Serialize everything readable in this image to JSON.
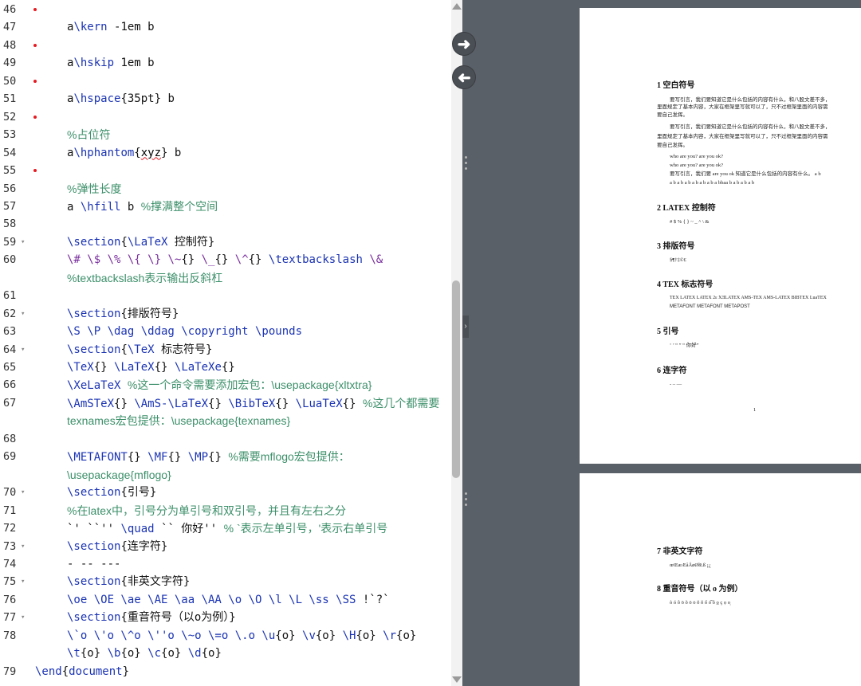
{
  "editor": {
    "lines": [
      {
        "ln": "46",
        "dot": true,
        "fold": false,
        "segs": []
      },
      {
        "ln": "47",
        "dot": false,
        "fold": false,
        "segs": [
          [
            "pl",
            "a"
          ],
          [
            "cmd",
            "\\kern"
          ],
          [
            "pl",
            " -1em b"
          ]
        ]
      },
      {
        "ln": "48",
        "dot": true,
        "fold": false,
        "segs": []
      },
      {
        "ln": "49",
        "dot": false,
        "fold": false,
        "segs": [
          [
            "pl",
            "a"
          ],
          [
            "cmd",
            "\\hskip"
          ],
          [
            "pl",
            " 1em b"
          ]
        ]
      },
      {
        "ln": "50",
        "dot": true,
        "fold": false,
        "segs": []
      },
      {
        "ln": "51",
        "dot": false,
        "fold": false,
        "segs": [
          [
            "pl",
            "a"
          ],
          [
            "cmd",
            "\\hspace"
          ],
          [
            "pl",
            "{35pt} b"
          ]
        ]
      },
      {
        "ln": "52",
        "dot": true,
        "fold": false,
        "segs": []
      },
      {
        "ln": "53",
        "dot": false,
        "fold": false,
        "segs": [
          [
            "cm",
            "%占位符"
          ]
        ]
      },
      {
        "ln": "54",
        "dot": false,
        "fold": false,
        "segs": [
          [
            "pl",
            "a"
          ],
          [
            "cmd",
            "\\hphantom"
          ],
          [
            "pl",
            "{"
          ],
          [
            "sq",
            "xyz"
          ],
          [
            "pl",
            "} b"
          ]
        ]
      },
      {
        "ln": "55",
        "dot": true,
        "fold": false,
        "segs": []
      },
      {
        "ln": "56",
        "dot": false,
        "fold": false,
        "segs": [
          [
            "cm",
            "%弹性长度"
          ]
        ]
      },
      {
        "ln": "57",
        "dot": false,
        "fold": false,
        "segs": [
          [
            "pl",
            "a "
          ],
          [
            "cmd",
            "\\hfill"
          ],
          [
            "pl",
            " b   "
          ],
          [
            "cm",
            "%撑满整个空间"
          ]
        ]
      },
      {
        "ln": "58",
        "dot": false,
        "fold": false,
        "segs": []
      },
      {
        "ln": "59",
        "dot": false,
        "fold": true,
        "segs": [
          [
            "cmd",
            "\\section"
          ],
          [
            "pl",
            "{"
          ],
          [
            "cmd",
            "\\LaTeX"
          ],
          [
            "pl",
            " 控制符}"
          ]
        ]
      },
      {
        "ln": "60",
        "dot": false,
        "fold": false,
        "segs": [
          [
            "kw",
            "\\# \\$ \\% \\{ \\}"
          ],
          [
            "pl",
            " "
          ],
          [
            "kw",
            "\\~"
          ],
          [
            "pl",
            "{} "
          ],
          [
            "kw",
            "\\_"
          ],
          [
            "pl",
            "{} "
          ],
          [
            "kw",
            "\\^"
          ],
          [
            "pl",
            "{} "
          ],
          [
            "cmd",
            "\\textbackslash"
          ],
          [
            "pl",
            " "
          ],
          [
            "kw",
            "\\&"
          ]
        ]
      },
      {
        "ln": "",
        "dot": false,
        "fold": false,
        "segs": [
          [
            "cm",
            "%textbackslash表示输出反斜杠"
          ]
        ]
      },
      {
        "ln": "61",
        "dot": false,
        "fold": false,
        "segs": []
      },
      {
        "ln": "62",
        "dot": false,
        "fold": true,
        "segs": [
          [
            "cmd",
            "\\section"
          ],
          [
            "pl",
            "{排版符号}"
          ]
        ]
      },
      {
        "ln": "63",
        "dot": false,
        "fold": false,
        "segs": [
          [
            "cmd",
            "\\S \\P \\dag \\ddag \\copyright \\pounds"
          ]
        ]
      },
      {
        "ln": "64",
        "dot": false,
        "fold": true,
        "segs": [
          [
            "cmd",
            "\\section"
          ],
          [
            "pl",
            "{"
          ],
          [
            "cmd",
            "\\TeX"
          ],
          [
            "pl",
            " 标志符号}"
          ]
        ]
      },
      {
        "ln": "65",
        "dot": false,
        "fold": false,
        "segs": [
          [
            "cmd",
            "\\TeX"
          ],
          [
            "pl",
            "{} "
          ],
          [
            "cmd",
            "\\LaTeX"
          ],
          [
            "pl",
            "{} "
          ],
          [
            "cmd",
            "\\LaTeXe"
          ],
          [
            "pl",
            "{}"
          ]
        ]
      },
      {
        "ln": "66",
        "dot": false,
        "fold": false,
        "segs": [
          [
            "cmd",
            "\\XeLaTeX"
          ],
          [
            "pl",
            "  "
          ],
          [
            "cm",
            "%这一个命令需要添加宏包：\\usepackage{xltxtra}"
          ]
        ]
      },
      {
        "ln": "67",
        "dot": false,
        "fold": false,
        "segs": [
          [
            "cmd",
            "\\AmSTeX"
          ],
          [
            "pl",
            "{} "
          ],
          [
            "cmd",
            "\\AmS-\\LaTeX"
          ],
          [
            "pl",
            "{} "
          ],
          [
            "cmd",
            "\\BibTeX"
          ],
          [
            "pl",
            "{} "
          ],
          [
            "cmd",
            "\\LuaTeX"
          ],
          [
            "pl",
            "{} "
          ],
          [
            "cm",
            "%这几个都需要"
          ]
        ]
      },
      {
        "ln": "",
        "dot": false,
        "fold": false,
        "segs": [
          [
            "cm",
            "texnames宏包提供：\\usepackage{texnames}"
          ]
        ]
      },
      {
        "ln": "68",
        "dot": false,
        "fold": false,
        "segs": []
      },
      {
        "ln": "69",
        "dot": false,
        "fold": false,
        "segs": [
          [
            "cmd",
            "\\METAFONT"
          ],
          [
            "pl",
            "{} "
          ],
          [
            "cmd",
            "\\MF"
          ],
          [
            "pl",
            "{} "
          ],
          [
            "cmd",
            "\\MP"
          ],
          [
            "pl",
            "{} "
          ],
          [
            "cm",
            "%需要mflogo宏包提供："
          ]
        ]
      },
      {
        "ln": "",
        "dot": false,
        "fold": false,
        "segs": [
          [
            "cm",
            "\\usepackage{mflogo}"
          ]
        ]
      },
      {
        "ln": "70",
        "dot": false,
        "fold": true,
        "segs": [
          [
            "cmd",
            "\\section"
          ],
          [
            "pl",
            "{引号}"
          ]
        ]
      },
      {
        "ln": "71",
        "dot": false,
        "fold": false,
        "segs": [
          [
            "cm",
            "%在latex中，引号分为单引号和双引号，并且有左右之分"
          ]
        ]
      },
      {
        "ln": "72",
        "dot": false,
        "fold": false,
        "segs": [
          [
            "pl",
            "`' ``'' "
          ],
          [
            "cmd",
            "\\quad"
          ],
          [
            "pl",
            "   `` 你好'' "
          ],
          [
            "cm",
            "% `表示左单引号，'表示右单引号"
          ]
        ]
      },
      {
        "ln": "73",
        "dot": false,
        "fold": true,
        "segs": [
          [
            "cmd",
            "\\section"
          ],
          [
            "pl",
            "{连字符}"
          ]
        ]
      },
      {
        "ln": "74",
        "dot": false,
        "fold": false,
        "segs": [
          [
            "pl",
            "- -- ---"
          ]
        ]
      },
      {
        "ln": "75",
        "dot": false,
        "fold": true,
        "segs": [
          [
            "cmd",
            "\\section"
          ],
          [
            "pl",
            "{非英文字符}"
          ]
        ]
      },
      {
        "ln": "76",
        "dot": false,
        "fold": false,
        "segs": [
          [
            "cmd",
            "\\oe \\OE \\ae \\AE \\aa \\AA \\o \\O \\l \\L \\ss \\SS"
          ],
          [
            "pl",
            " !`?`"
          ]
        ]
      },
      {
        "ln": "77",
        "dot": false,
        "fold": true,
        "segs": [
          [
            "cmd",
            "\\section"
          ],
          [
            "pl",
            "{重音符号（以o为例）}"
          ]
        ]
      },
      {
        "ln": "78",
        "dot": false,
        "fold": false,
        "segs": [
          [
            "cmd",
            "\\`o \\'o \\^o \\''o \\~o \\=o \\.o \\u"
          ],
          [
            "pl",
            "{o} "
          ],
          [
            "cmd",
            "\\v"
          ],
          [
            "pl",
            "{o} "
          ],
          [
            "cmd",
            "\\H"
          ],
          [
            "pl",
            "{o} "
          ],
          [
            "cmd",
            "\\r"
          ],
          [
            "pl",
            "{o}"
          ]
        ]
      },
      {
        "ln": "",
        "dot": false,
        "fold": false,
        "segs": [
          [
            "cmd",
            "\\t"
          ],
          [
            "pl",
            "{o} "
          ],
          [
            "cmd",
            "\\b"
          ],
          [
            "pl",
            "{o} "
          ],
          [
            "cmd",
            "\\c"
          ],
          [
            "pl",
            "{o} "
          ],
          [
            "cmd",
            "\\d"
          ],
          [
            "pl",
            "{o}"
          ]
        ]
      },
      {
        "ln": "79",
        "dot": false,
        "fold": false,
        "end": true,
        "segs": [
          [
            "cmd",
            "\\end"
          ],
          [
            "pl",
            "{"
          ],
          [
            "arg",
            "document"
          ],
          [
            "pl",
            "}"
          ]
        ]
      }
    ]
  },
  "nav": {
    "forward_icon": "arrow-right-icon",
    "back_icon": "arrow-left-icon"
  },
  "pdf": {
    "page1": {
      "s1_title": "1  空白符号",
      "s1_p1": "要写引言，我们要知道它是什么包括的内容有什么，和八股文差不多，",
      "s1_p2": "里面规定了基本内容，大家在框架里写就可以了，只不过框架里面的内容需",
      "s1_p3": "要自己发挥。",
      "s1_p4": "要写引言，我们要知道它是什么包括的内容有什么，和八股文差不多，",
      "s1_p5": "里面规定了基本内容，大家在框架里写就可以了，只不过框架里面的内容需",
      "s1_p6": "要自己发挥。",
      "s1_p7": "who are you? are you ok?",
      "s1_p8": "who are you? are you ok?",
      "s1_p9": "要写引言，我们要 are you ok 知道它是什么包括的内容有什么。 a    b",
      "s1_p10": "a     b a b a b a  b a b a b a   bbaa  b a           b a     b a b",
      "s2_title": "2  LATEX 控制符",
      "s2_body": "# $ % { } ~ _ ^ \\ &",
      "s3_title": "3  排版符号",
      "s3_body": "§¶†‡©£",
      "s4_title": "4  TEX 标志符号",
      "s4_body1": "TEX LATEX LATEX 2ε XƎLATEX AMS-TEX AMS-LATEX BIBTEX LuaTEX",
      "s4_body2": "METAFONT METAFONT METAPOST",
      "s5_title": "5  引号",
      "s5_body": "‘ ’ “ ”    “ 你好”",
      "s6_title": "6  连字符",
      "s6_body": "- – —",
      "page_number": "1"
    },
    "page2": {
      "s7_title": "7  非英文字符",
      "s7_body": "œŒæÆåÅøØłŁß ¡¿",
      "s8_title": "8  重音符号（以 o 为例）",
      "s8_body": "ò ó ô ö õ ō ȯ ŏ ǒ ő o͡ ȏ o̲ ç ọ o̦"
    }
  }
}
